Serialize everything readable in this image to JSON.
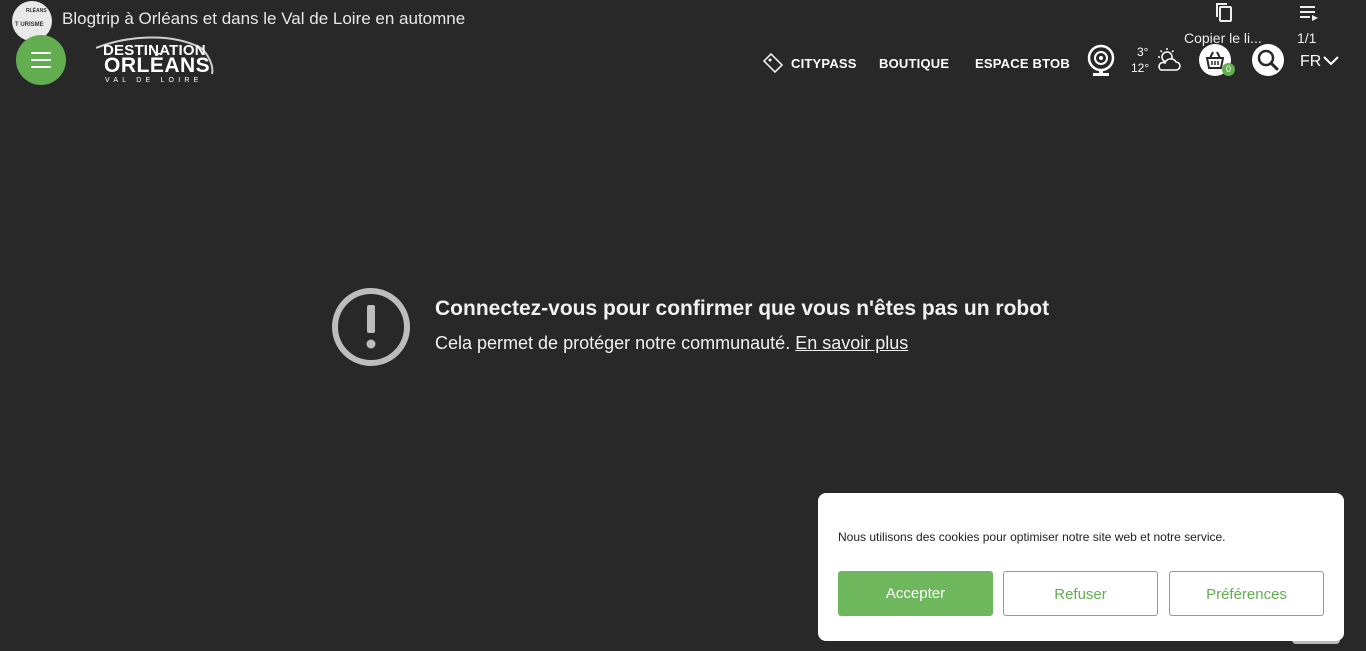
{
  "video": {
    "channel_avatar_line1": "RLÉANS",
    "channel_avatar_line2": "T URISME",
    "title": "Blogtrip à Orléans et dans le Val de Loire en automne",
    "copy_label": "Copier le li...",
    "playlist_counter": "1/1",
    "icons": {
      "copy": "copy-icon",
      "playlist": "playlist-icon"
    }
  },
  "header": {
    "logo": {
      "line1": "DESTINATION",
      "line2": "ORLÉANS",
      "line3": "VAL DE LOIRE"
    },
    "nav": {
      "citypass": "CITYPASS",
      "boutique": "BOUTIQUE",
      "btob": "ESPACE BTOB"
    },
    "weather": {
      "temp_low": "3°",
      "temp_high": "12°"
    },
    "cart_count": "0",
    "language": "FR",
    "icons": {
      "menu": "hamburger-icon",
      "ticket": "ticket-icon",
      "webcam": "webcam-icon",
      "weather": "partly-cloudy-icon",
      "cart": "basket-icon",
      "search": "search-icon",
      "chevron": "chevron-down-icon"
    }
  },
  "message": {
    "title": "Connectez-vous pour confirmer que vous n'êtes pas un robot",
    "text": "Cela permet de protéger notre communauté.",
    "link": "En savoir plus",
    "icon": "alert-circle-icon"
  },
  "cookie": {
    "text": "Nous utilisons des cookies pour optimiser notre site web et notre service.",
    "accept": "Accepter",
    "refuse": "Refuser",
    "preferences": "Préférences"
  },
  "colors": {
    "background": "#282828",
    "accent_green": "#63ad51",
    "panel": "#ffffff"
  }
}
